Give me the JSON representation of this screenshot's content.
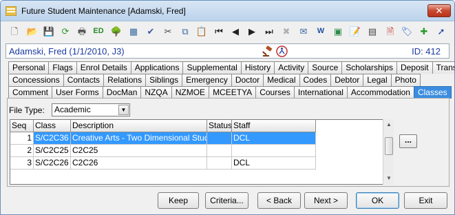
{
  "window": {
    "title": "Future Student Maintenance  [Adamski, Fred]",
    "close_label": "✕"
  },
  "toolbar": {
    "icons": [
      {
        "name": "new-document-icon",
        "glyph": "🗋",
        "color": "#555555"
      },
      {
        "name": "open-folder-icon",
        "glyph": "📂",
        "color": "#d9a520"
      },
      {
        "name": "save-icon",
        "glyph": "💾",
        "color": "#9a9a9a"
      },
      {
        "name": "refresh-icon",
        "glyph": "⟳",
        "color": "#2a9a2a"
      },
      {
        "name": "print-icon",
        "glyph": "🖶",
        "color": "#555555"
      },
      {
        "name": "edit-id-icon",
        "glyph": "ED",
        "color": "#2a8a2a"
      },
      {
        "name": "family-tree-icon",
        "glyph": "🌳",
        "color": "#2a7a2a"
      },
      {
        "name": "calculator-icon",
        "glyph": "▦",
        "color": "#3a6aa0"
      },
      {
        "name": "spellcheck-icon",
        "glyph": "✔",
        "color": "#3a5aa0"
      },
      {
        "name": "cut-icon",
        "glyph": "✂",
        "color": "#444444"
      },
      {
        "name": "copy-icon",
        "glyph": "⧉",
        "color": "#3a6aa0"
      },
      {
        "name": "paste-icon",
        "glyph": "📋",
        "color": "#b08030"
      },
      {
        "name": "first-record-icon",
        "glyph": "⏮",
        "color": "#222222"
      },
      {
        "name": "previous-record-icon",
        "glyph": "◀",
        "color": "#222222"
      },
      {
        "name": "next-record-icon",
        "glyph": "▶",
        "color": "#222222"
      },
      {
        "name": "last-record-icon",
        "glyph": "⏭",
        "color": "#222222"
      },
      {
        "name": "delete-icon",
        "glyph": "✖",
        "color": "#b0b0b0"
      },
      {
        "name": "email-icon",
        "glyph": "✉",
        "color": "#3a6aa0"
      },
      {
        "name": "word-icon",
        "glyph": "W",
        "color": "#1f4fa0"
      },
      {
        "name": "excel-grid-icon",
        "glyph": "▣",
        "color": "#2a8a4a"
      },
      {
        "name": "notes-icon",
        "glyph": "📝",
        "color": "#b08030"
      },
      {
        "name": "calendar-icon",
        "glyph": "▤",
        "color": "#444444"
      },
      {
        "name": "mail-merge-icon",
        "glyph": "🗎",
        "color": "#c03030"
      },
      {
        "name": "tag-icon",
        "glyph": "🏷",
        "color": "#3a6ad0"
      },
      {
        "name": "add-note-icon",
        "glyph": "✚",
        "color": "#2a9a2a"
      },
      {
        "name": "pointer-arrow-icon",
        "glyph": "➚",
        "color": "#1a3aa0"
      }
    ]
  },
  "info": {
    "name": "Adamski, Fred (1/1/2010, J3)",
    "id_text": "ID: 412"
  },
  "tabs": {
    "row1": [
      "Personal",
      "Flags",
      "Enrol Details",
      "Applications",
      "Supplemental",
      "History",
      "Activity",
      "Source",
      "Scholarships",
      "Deposit",
      "Transport"
    ],
    "row2": [
      "Concessions",
      "Contacts",
      "Relations",
      "Siblings",
      "Emergency",
      "Doctor",
      "Medical",
      "Codes",
      "Debtor",
      "Legal",
      "Photo"
    ],
    "row3": [
      "Comment",
      "User Forms",
      "DocMan",
      "NZQA",
      "NZMOE",
      "MCEETYA",
      "Courses",
      "International",
      "Accommodation",
      "Classes"
    ],
    "active": "Classes"
  },
  "filetype": {
    "label": "File Type:",
    "value": "Academic"
  },
  "grid": {
    "columns": [
      "Seq",
      "Class",
      "Description",
      "Status",
      "Staff"
    ],
    "rows": [
      {
        "seq": "1",
        "class": "S/C2C36",
        "description": "Creative Arts - Two Dimensional Studies",
        "status": "",
        "staff": "DCL"
      },
      {
        "seq": "2",
        "class": "S/C2C25",
        "description": "C2C25",
        "status": "",
        "staff": ""
      },
      {
        "seq": "3",
        "class": "S/C2C26",
        "description": "C2C26",
        "status": "",
        "staff": "DCL"
      }
    ],
    "selected_row": 0,
    "ellipsis_label": "..."
  },
  "buttons": {
    "keep": "Keep",
    "criteria": "Criteria...",
    "back": "< Back",
    "next": "Next >",
    "ok": "OK",
    "exit": "Exit"
  }
}
